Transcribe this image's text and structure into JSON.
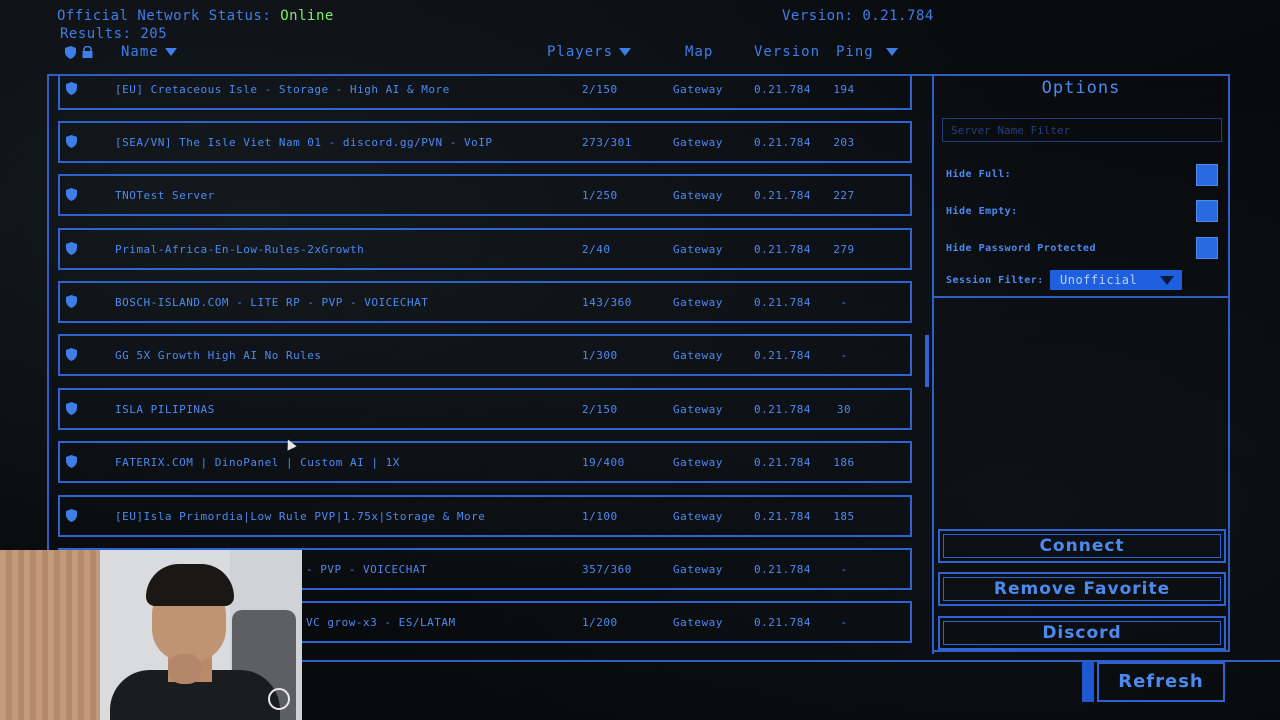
{
  "header": {
    "status_label": "Official Network Status:",
    "status_value": "Online",
    "results_label": "Results:",
    "results_count": "205",
    "version_label": "Version:",
    "version_value": "0.21.784",
    "columns": {
      "name": "Name",
      "players": "Players",
      "map": "Map",
      "version": "Version",
      "ping": "Ping"
    }
  },
  "servers": [
    {
      "name": "[EU] Cretaceous Isle - Storage - High AI & More",
      "players": "2/150",
      "map": "Gateway",
      "version": "0.21.784",
      "ping": "194"
    },
    {
      "name": "[SEA/VN] The Isle Viet Nam 01 - discord.gg/PVN - VoIP",
      "players": "273/301",
      "map": "Gateway",
      "version": "0.21.784",
      "ping": "203"
    },
    {
      "name": "TNOTest Server",
      "players": "1/250",
      "map": "Gateway",
      "version": "0.21.784",
      "ping": "227"
    },
    {
      "name": "Primal-Africa-En-Low-Rules-2xGrowth",
      "players": "2/40",
      "map": "Gateway",
      "version": "0.21.784",
      "ping": "279"
    },
    {
      "name": "BOSCH-ISLAND.COM - LITE RP - PVP - VOICECHAT",
      "players": "143/360",
      "map": "Gateway",
      "version": "0.21.784",
      "ping": "-"
    },
    {
      "name": "GG 5X Growth High AI No Rules",
      "players": "1/300",
      "map": "Gateway",
      "version": "0.21.784",
      "ping": "-"
    },
    {
      "name": "ISLA PILIPINAS",
      "players": "2/150",
      "map": "Gateway",
      "version": "0.21.784",
      "ping": "30"
    },
    {
      "name": "FATERIX.COM | DinoPanel | Custom AI | 1X",
      "players": "19/400",
      "map": "Gateway",
      "version": "0.21.784",
      "ping": "186"
    },
    {
      "name": "[EU]Isla Primordia|Low Rule PVP|1.75x|Storage & More",
      "players": "1/100",
      "map": "Gateway",
      "version": "0.21.784",
      "ping": "185"
    },
    {
      "name": "- PVP - VOICECHAT",
      "players": "357/360",
      "map": "Gateway",
      "version": "0.21.784",
      "ping": "-"
    },
    {
      "name": "VC grow-x3 - ES/LATAM",
      "players": "1/200",
      "map": "Gateway",
      "version": "0.21.784",
      "ping": "-"
    }
  ],
  "options": {
    "title": "Options",
    "filter_placeholder": "Server Name Filter",
    "hide_full": "Hide Full:",
    "hide_empty": "Hide Empty:",
    "hide_password": "Hide Password Protected",
    "session_filter_label": "Session Filter:",
    "session_filter_value": "Unofficial"
  },
  "buttons": {
    "connect": "Connect",
    "remove_favorite": "Remove Favorite",
    "discord": "Discord",
    "refresh": "Refresh"
  },
  "colors": {
    "accent": "#3f7ee8",
    "online": "#7ef06a",
    "checkbox": "#2a6ae0"
  },
  "icons": {
    "row": "shield-icon",
    "header_favorite": "shield-icon",
    "header_password": "lock-icon",
    "sort": "triangle-down-icon"
  }
}
